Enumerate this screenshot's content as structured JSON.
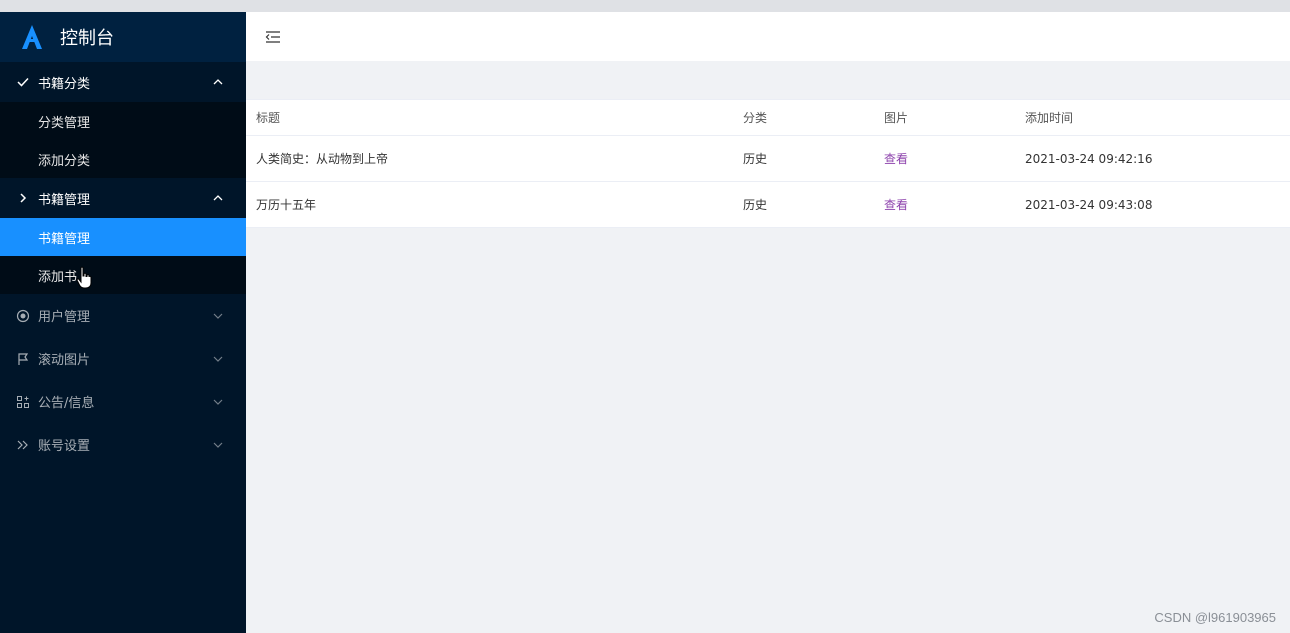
{
  "app": {
    "title": "控制台"
  },
  "sidebar": {
    "groups": [
      {
        "label": "书籍分类",
        "icon": "check-icon",
        "expanded": true,
        "items": [
          {
            "label": "分类管理",
            "active": false
          },
          {
            "label": "添加分类",
            "active": false
          }
        ]
      },
      {
        "label": "书籍管理",
        "icon": "chevron-right-icon",
        "expanded": true,
        "items": [
          {
            "label": "书籍管理",
            "active": true
          },
          {
            "label": "添加书",
            "active": false
          }
        ]
      }
    ],
    "items": [
      {
        "label": "用户管理",
        "icon": "radio-circle-icon"
      },
      {
        "label": "滚动图片",
        "icon": "flag-icon"
      },
      {
        "label": "公告/信息",
        "icon": "grid-plus-icon"
      },
      {
        "label": "账号设置",
        "icon": "double-chevron-right-icon"
      }
    ]
  },
  "table": {
    "columns": [
      "标题",
      "分类",
      "图片",
      "添加时间"
    ],
    "rows": [
      {
        "title": "人类简史：从动物到上帝",
        "category": "历史",
        "image": "查看",
        "time": "2021-03-24 09:42:16"
      },
      {
        "title": "万历十五年",
        "category": "历史",
        "image": "查看",
        "time": "2021-03-24 09:43:08"
      }
    ]
  },
  "watermark": "CSDN @l961903965",
  "colors": {
    "sidebar": "#001529",
    "submenu": "#000c17",
    "active": "#1890ff",
    "link": "#8e44ad"
  }
}
